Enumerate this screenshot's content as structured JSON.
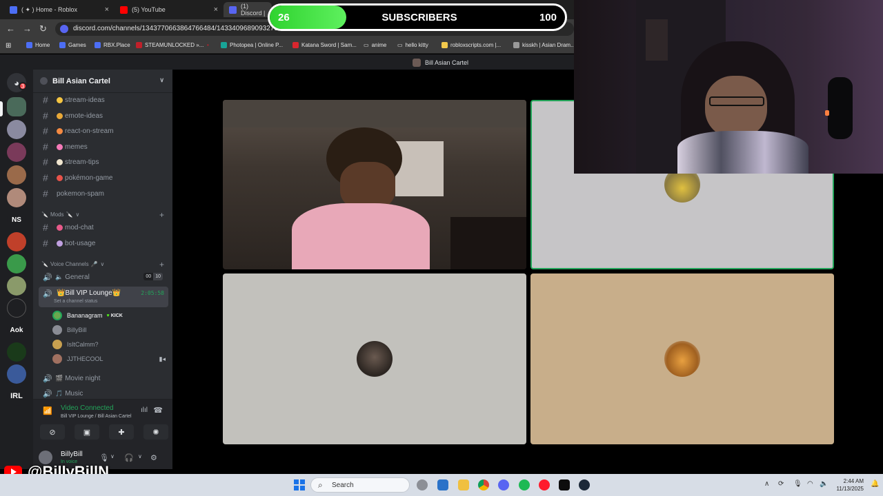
{
  "browser": {
    "tabs": [
      {
        "label": "( ✦ ) Home - Roblox",
        "color": "#4c6ef5"
      },
      {
        "label": "(5) YouTube",
        "color": "#ff0000"
      },
      {
        "label": "(1) Discord |",
        "color": "#5865f2"
      }
    ],
    "url": "discord.com/channels/1343770663864766484/1433409689093279877",
    "bookmarks": [
      {
        "label": "Home",
        "color": "#4c6ef5"
      },
      {
        "label": "Games",
        "color": "#4c6ef5"
      },
      {
        "label": "RBX.Place",
        "color": "#4c6ef5"
      },
      {
        "label": "STEAMUNLOCKED »...",
        "color": "#c0202a"
      },
      {
        "label": "Photopea | Online P...",
        "color": "#18a497"
      },
      {
        "label": "Katana Sword | Sam...",
        "color": "#d9262e"
      },
      {
        "label": "anime",
        "color": "folder"
      },
      {
        "label": "hello kitty",
        "color": "folder"
      },
      {
        "label": "robloxscripts.com |...",
        "color": "#f2c94c"
      },
      {
        "label": "kisskh | Asian Dram...",
        "color": "#999999"
      }
    ]
  },
  "discord": {
    "window_title": "Bill Asian Cartel",
    "notification_count": "3",
    "rail_labels": [
      "NS",
      "Aok",
      "IRL"
    ],
    "server_name": "Bill Asian Cartel",
    "channels": [
      {
        "name": "stream-ideas",
        "emoji_color": "#f5c542"
      },
      {
        "name": "emote-ideas",
        "emoji_color": "#e8a838"
      },
      {
        "name": "react-on-stream",
        "emoji_color": "#f58a42"
      },
      {
        "name": "memes",
        "emoji_color": "#f57ab8"
      },
      {
        "name": "stream-tips",
        "emoji_color": "#f0e6d0"
      },
      {
        "name": "pokémon-game",
        "emoji_color": "#e8534a"
      },
      {
        "name": "pokemon-spam",
        "emoji_color": ""
      }
    ],
    "mods_category": "Mods",
    "mod_channels": [
      {
        "name": "mod-chat",
        "emoji_color": "#e85a8a"
      },
      {
        "name": "bot-usage",
        "emoji_color": "#c0a0e0"
      }
    ],
    "voice_category": "Voice Channels",
    "voice_general": {
      "name": "General",
      "count_a": "00",
      "count_b": "10"
    },
    "vip": {
      "name": "Bill VIP Lounge",
      "status": "Set a channel status",
      "timer": "2:05:58"
    },
    "members": [
      {
        "name": "Bananagram",
        "kick": "KICK",
        "color": "#6aa84f"
      },
      {
        "name": "BillyBill",
        "kick": "",
        "color": "#8a8c94"
      },
      {
        "name": "IsItCalmm?",
        "kick": "",
        "color": "#c8a050"
      },
      {
        "name": "JJTHECOOL",
        "kick": "",
        "color": "#a07060"
      }
    ],
    "voice_more": [
      {
        "name": "Movie night"
      },
      {
        "name": "Music"
      }
    ],
    "voice_panel": {
      "title": "Video Connected",
      "location": "Bill VIP Lounge / Bill Asian Cartel"
    },
    "user": {
      "name": "BillyBill",
      "status": "In voice"
    }
  },
  "overlay": {
    "subscribers_current": "26",
    "subscribers_label": "SUBSCRIBERS",
    "subscribers_goal": "100",
    "progress_fraction": 0.26,
    "handle": "@BillyBillN"
  },
  "taskbar": {
    "search_placeholder": "Search",
    "time": "2:44 AM",
    "date": "11/13/2025"
  }
}
